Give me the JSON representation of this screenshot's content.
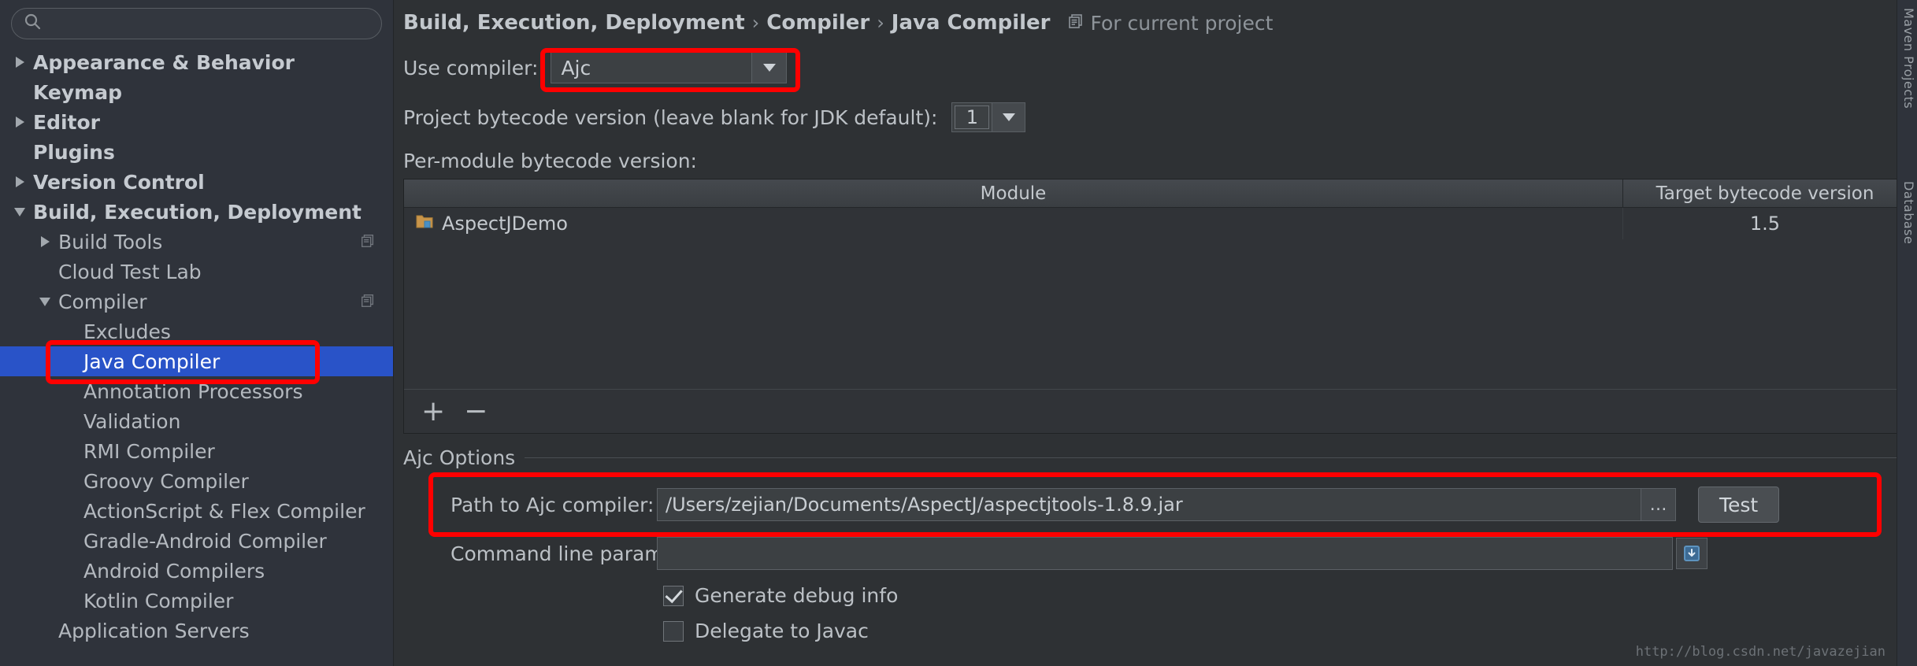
{
  "sidebar": {
    "search": {
      "value": "",
      "placeholder": "",
      "icon": "search-icon"
    },
    "items": [
      {
        "label": "Appearance & Behavior",
        "twisty": "right",
        "indent": 0,
        "bold": true,
        "selected": false,
        "copy": false
      },
      {
        "label": "Keymap",
        "twisty": "none",
        "indent": 0,
        "bold": true,
        "selected": false,
        "copy": false
      },
      {
        "label": "Editor",
        "twisty": "right",
        "indent": 0,
        "bold": true,
        "selected": false,
        "copy": false
      },
      {
        "label": "Plugins",
        "twisty": "none",
        "indent": 0,
        "bold": true,
        "selected": false,
        "copy": false
      },
      {
        "label": "Version Control",
        "twisty": "right",
        "indent": 0,
        "bold": true,
        "selected": false,
        "copy": false
      },
      {
        "label": "Build, Execution, Deployment",
        "twisty": "down",
        "indent": 0,
        "bold": true,
        "selected": false,
        "copy": false
      },
      {
        "label": "Build Tools",
        "twisty": "right",
        "indent": 1,
        "bold": false,
        "selected": false,
        "copy": true
      },
      {
        "label": "Cloud Test Lab",
        "twisty": "none",
        "indent": 1,
        "bold": false,
        "selected": false,
        "copy": false
      },
      {
        "label": "Compiler",
        "twisty": "down",
        "indent": 1,
        "bold": false,
        "selected": false,
        "copy": true
      },
      {
        "label": "Excludes",
        "twisty": "none",
        "indent": 2,
        "bold": false,
        "selected": false,
        "copy": false
      },
      {
        "label": "Java Compiler",
        "twisty": "none",
        "indent": 2,
        "bold": false,
        "selected": true,
        "copy": false
      },
      {
        "label": "Annotation Processors",
        "twisty": "none",
        "indent": 2,
        "bold": false,
        "selected": false,
        "copy": false
      },
      {
        "label": "Validation",
        "twisty": "none",
        "indent": 2,
        "bold": false,
        "selected": false,
        "copy": false
      },
      {
        "label": "RMI Compiler",
        "twisty": "none",
        "indent": 2,
        "bold": false,
        "selected": false,
        "copy": false
      },
      {
        "label": "Groovy Compiler",
        "twisty": "none",
        "indent": 2,
        "bold": false,
        "selected": false,
        "copy": false
      },
      {
        "label": "ActionScript & Flex Compiler",
        "twisty": "none",
        "indent": 2,
        "bold": false,
        "selected": false,
        "copy": false
      },
      {
        "label": "Gradle-Android Compiler",
        "twisty": "none",
        "indent": 2,
        "bold": false,
        "selected": false,
        "copy": false
      },
      {
        "label": "Android Compilers",
        "twisty": "none",
        "indent": 2,
        "bold": false,
        "selected": false,
        "copy": false
      },
      {
        "label": "Kotlin Compiler",
        "twisty": "none",
        "indent": 2,
        "bold": false,
        "selected": false,
        "copy": false
      },
      {
        "label": "Application Servers",
        "twisty": "none",
        "indent": 1,
        "bold": false,
        "selected": false,
        "copy": false
      }
    ]
  },
  "breadcrumb": {
    "crumb1": "Build, Execution, Deployment",
    "sep1": "›",
    "crumb2": "Compiler",
    "sep2": "›",
    "crumb3": "Java Compiler",
    "scope_icon": "copy-icon",
    "scope_label": "For current project"
  },
  "use_compiler": {
    "label": "Use compiler:",
    "value": "Ajc",
    "arrow_icon": "chevron-down-icon"
  },
  "project_bytecode": {
    "label": "Project bytecode version (leave blank for JDK default):",
    "value": "1",
    "arrow_icon": "chevron-down-icon"
  },
  "per_module": {
    "label": "Per-module bytecode version:",
    "columns": [
      "Module",
      "Target bytecode version"
    ],
    "rows": [
      {
        "module": "AspectJDemo",
        "icon": "module-folder-icon",
        "target": "1.5"
      }
    ],
    "add_label": "+",
    "remove_label": "−"
  },
  "ajc_options": {
    "title": "Ajc Options",
    "path_label": "Path to Ajc compiler:",
    "path_value": "/Users/zejian/Documents/AspectJ/aspectjtools-1.8.9.jar",
    "browse_label": "…",
    "test_label": "Test",
    "cmdline_label": "Command line parameters:",
    "cmdline_value": "",
    "expand_icon": "expand-editor-icon",
    "checkboxes": [
      {
        "label": "Generate debug info",
        "checked": true
      },
      {
        "label": "Delegate to Javac",
        "checked": false
      }
    ]
  },
  "right_tabs": [
    {
      "label": "Maven Projects"
    },
    {
      "label": "Database"
    }
  ],
  "watermark": "http://blog.csdn.net/javazejian",
  "colors": {
    "selection": "#2953c8",
    "annotation": "#ff0000",
    "sidebar_bg": "#2f333b",
    "panel_bg": "#2e3134"
  }
}
